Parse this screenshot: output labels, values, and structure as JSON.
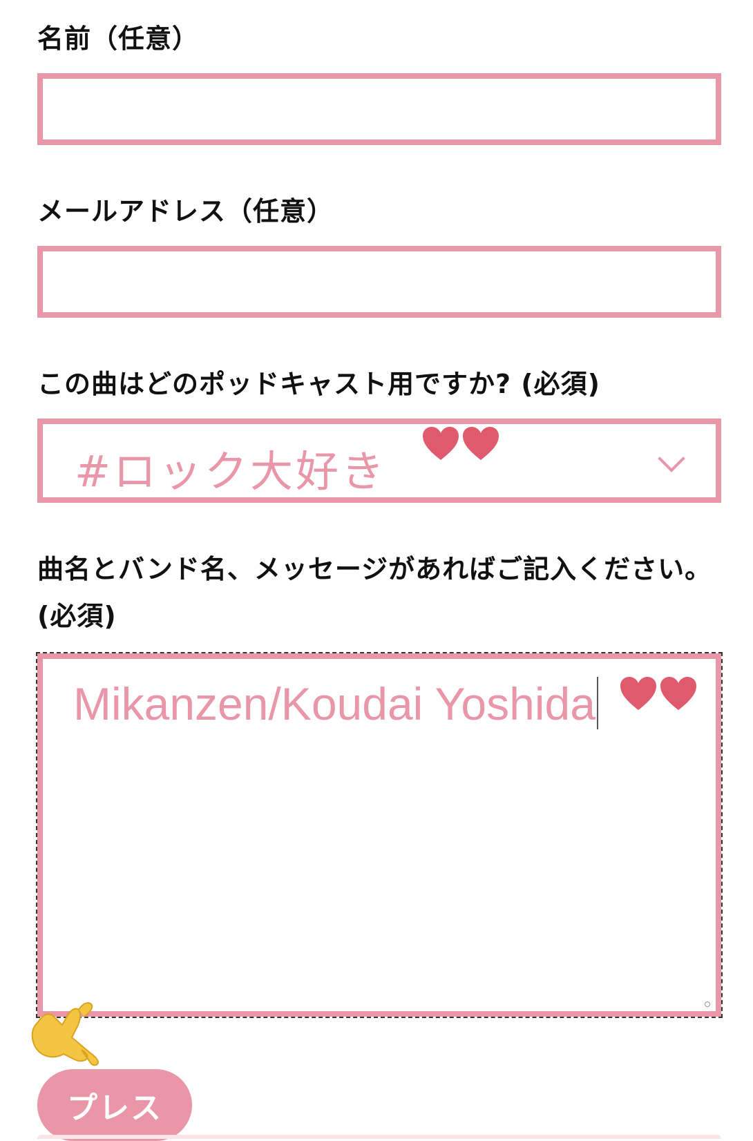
{
  "form": {
    "name": {
      "label": "名前（任意）",
      "value": "",
      "placeholder": ""
    },
    "email": {
      "label": "メールアドレス（任意）",
      "value": "",
      "placeholder": ""
    },
    "podcast": {
      "label": "この曲はどのポッドキャスト用ですか? (必須)",
      "selected": "#ロック大好き",
      "icon": "chevron-down-icon"
    },
    "message": {
      "label": "曲名とバンド名、メッセージがあればご記入ください。(必須)",
      "value": "Mikanzen/Koudai Yoshida"
    },
    "submit_label": "プレス"
  },
  "decorations": {
    "heart_color": "#e05a6e",
    "accent_color": "#e896a8",
    "hand_color": "#f4c542"
  }
}
